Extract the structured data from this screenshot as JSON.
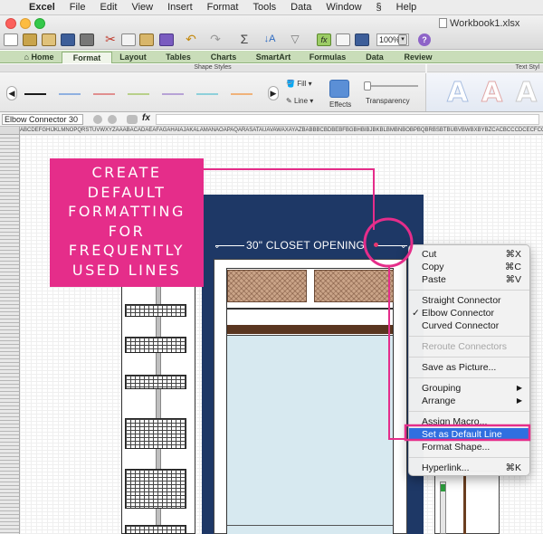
{
  "menubar": {
    "app": "Excel",
    "items": [
      "File",
      "Edit",
      "View",
      "Insert",
      "Format",
      "Tools",
      "Data",
      "Window",
      "Help"
    ]
  },
  "toolbar": {
    "zoom": "100%",
    "document_title": "Workbook1.xlsx"
  },
  "ribbon": {
    "tabs": [
      "Home",
      "Format",
      "Tables",
      "Charts",
      "SmartArt",
      "Formulas",
      "Data",
      "Review"
    ],
    "active_tab": "Format",
    "shape_styles_label": "Shape Styles",
    "text_styles_label": "Text Styl",
    "fill_label": "Fill",
    "line_label": "Line",
    "effects_label": "Effects",
    "transparency_label": "Transparency",
    "wordart_glyph": "A",
    "line_swatch_colors": [
      "#1a1a1a",
      "#8fb0e0",
      "#e08f8f",
      "#b8d08a",
      "#b7a3d6",
      "#8ed0da",
      "#f0b27a"
    ]
  },
  "formula_bar": {
    "name_box": "Elbow Connector 30",
    "fx": "fx",
    "formula": ""
  },
  "sheet": {
    "column_header_text": "ABCDEFGHIJKLMNOPQRSTUVWXYZAAABACADAEAFAGAHAIAJAKALAMANAOAPAQARASATAUAVAWAXAYAZBABBBCBDBEBFBGBHBIBJBKBLBMBNBOBPBQBRBSBTBUBVBWBXBYBZCACBCCCDCECFCGCHCICJCKCLCMCNCOCPCQCRCSCTCUCVCWCXCYCZ"
  },
  "drawing": {
    "dimension_label": "30\" CLOSET OPENING",
    "frame_color": "#1e3866"
  },
  "callout": {
    "lines": [
      "CREATE",
      "DEFAULT",
      "FORMATTING",
      "FOR",
      "FREQUENTLY",
      "USED LINES"
    ],
    "color": "#e52d8a"
  },
  "context_menu": {
    "cut": "Cut",
    "cut_shortcut": "⌘X",
    "copy": "Copy",
    "copy_shortcut": "⌘C",
    "paste": "Paste",
    "paste_shortcut": "⌘V",
    "straight_connector": "Straight Connector",
    "elbow_connector": "Elbow Connector",
    "elbow_check": "✓",
    "curved_connector": "Curved Connector",
    "reroute_connectors": "Reroute Connectors",
    "save_as_picture": "Save as Picture...",
    "grouping": "Grouping",
    "arrange": "Arrange",
    "assign_macro": "Assign Macro...",
    "set_as_default_line": "Set as Default Line",
    "format_shape": "Format Shape...",
    "hyperlink": "Hyperlink...",
    "hyperlink_shortcut": "⌘K",
    "highlight_color": "#2f6fe0"
  }
}
